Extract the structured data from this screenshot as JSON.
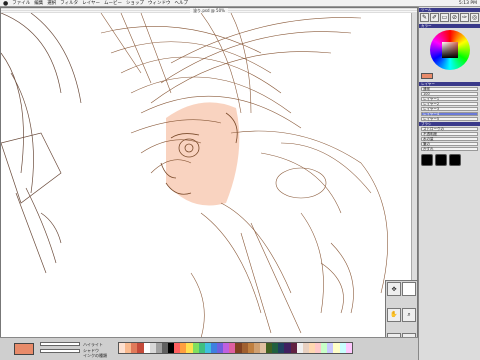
{
  "menubar": {
    "apple": "",
    "menus": [
      "ファイル",
      "編集",
      "選択",
      "フィルタ",
      "レイヤー",
      "ムービー",
      "ショップ",
      "ウィンドウ",
      "ヘルプ"
    ],
    "clock": "5:13 PM"
  },
  "document": {
    "title": "塗り.psd @ 50%"
  },
  "panels": {
    "tools_title": "ツール",
    "color_title": "カラー",
    "layers_title": "レイヤー",
    "layers": [
      "レイヤー1",
      "レイヤー2",
      "レイヤー3",
      "レイヤー4",
      "レイヤー5"
    ],
    "layer_mode": "通常",
    "layer_opacity": "100",
    "brush_title": "ブラシ",
    "brush_options": [
      "ストロークの",
      "不透明度",
      "水の量",
      "筆の",
      "かすれ"
    ],
    "bottom_opts": [
      "ハイライト",
      "シャドウ",
      "インクの種類"
    ]
  },
  "colors": {
    "accent": "#e88b6a",
    "palette": [
      "#fde0d0",
      "#f9b98e",
      "#e07a5a",
      "#c44a3a",
      "#ffffff",
      "#d8d8d8",
      "#a0a0a0",
      "#606060",
      "#000000",
      "#ff6060",
      "#ff9f3f",
      "#ffe04f",
      "#7fdf5f",
      "#3fbf7f",
      "#3fbfdf",
      "#3f7fdf",
      "#6f5fdf",
      "#bf5fdf",
      "#df5fa0",
      "#804020",
      "#a06030",
      "#c08040",
      "#d0a070",
      "#e0c0a0",
      "#406020",
      "#206040",
      "#204060",
      "#402060",
      "#602040",
      "#f0f0f0",
      "#e8d0c0",
      "#ffd8b0",
      "#ffc8c8",
      "#c8ffc8",
      "#c8c8ff",
      "#ffffc8",
      "#c8ffff",
      "#ffc8ff"
    ]
  }
}
